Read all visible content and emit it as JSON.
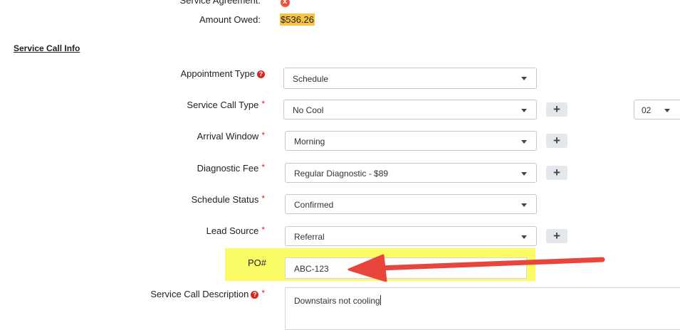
{
  "top": {
    "service_agreement_label": "Service Agreement:",
    "amount_owed_label": "Amount Owed:",
    "amount_owed_value": "$536.26"
  },
  "section_title": "Service Call Info",
  "fields": {
    "appointment_type": {
      "label": "Appointment Type",
      "value": "Schedule"
    },
    "service_call_type": {
      "label": "Service Call Type",
      "value": "No Cool",
      "side_value": "02"
    },
    "arrival_window": {
      "label": "Arrival Window",
      "value": "Morning"
    },
    "diagnostic_fee": {
      "label": "Diagnostic Fee",
      "value": "Regular Diagnostic - $89"
    },
    "schedule_status": {
      "label": "Schedule Status",
      "value": "Confirmed"
    },
    "lead_source": {
      "label": "Lead Source",
      "value": "Referral"
    },
    "po": {
      "label": "PO#",
      "value": "ABC-123"
    },
    "description": {
      "label": "Service Call Description",
      "value": "Downstairs not cooling"
    }
  },
  "symbols": {
    "required": "*",
    "help": "?",
    "plus": "+",
    "error": "x"
  },
  "colors": {
    "highlight": "#fbfc66",
    "arrow": "#e8453c",
    "required": "#d9261c",
    "amount_bg": "#f5c542"
  }
}
